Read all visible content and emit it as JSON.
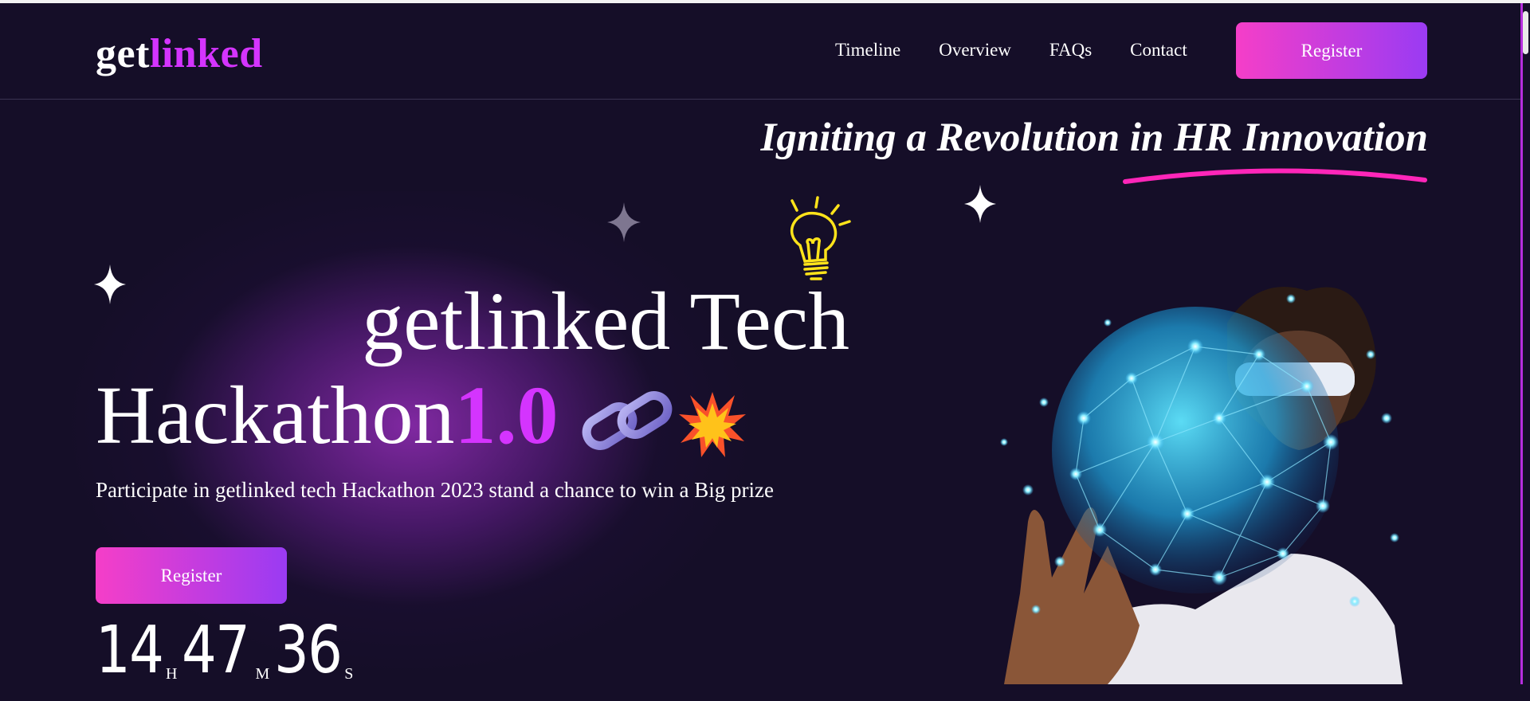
{
  "logo": {
    "part1": "get",
    "part2": "linked"
  },
  "nav": {
    "items": [
      "Timeline",
      "Overview",
      "FAQs",
      "Contact"
    ],
    "register_label": "Register"
  },
  "hero": {
    "tagline": "Igniting a Revolution in HR Innovation",
    "title_line1": "getlinked Tech",
    "title_line2": "Hackathon",
    "title_version": "1.0",
    "subtitle": "Participate in getlinked tech Hackathon 2023 stand a chance to win a Big prize",
    "register_label": "Register"
  },
  "countdown": {
    "hours": "14",
    "hours_unit": "H",
    "minutes": "47",
    "minutes_unit": "M",
    "seconds": "36",
    "seconds_unit": "S"
  },
  "colors": {
    "background": "#150e28",
    "accent": "#d434fe",
    "button_gradient_start": "#f53ec8",
    "button_gradient_end": "#9a3bf3"
  },
  "icons": [
    "sparkle-icon",
    "light-bulb-icon",
    "chain-link-icon",
    "collision-icon"
  ]
}
